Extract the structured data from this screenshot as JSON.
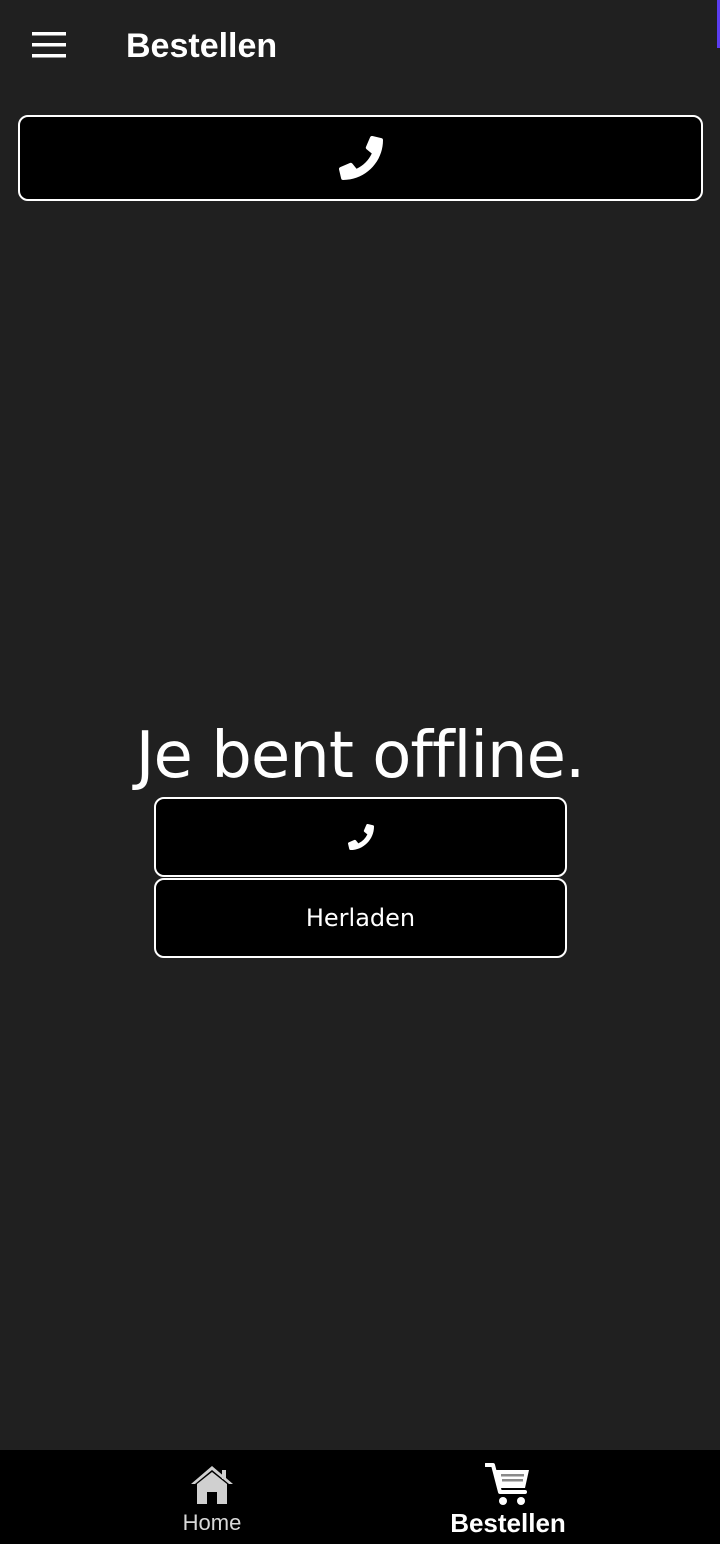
{
  "header": {
    "title": "Bestellen",
    "menu_icon": "hamburger-menu-icon"
  },
  "call_banner": {
    "icon": "phone-icon"
  },
  "offline": {
    "message": "Je bent offline.",
    "call_icon": "phone-icon",
    "reload_label": "Herladen"
  },
  "bottom_nav": {
    "items": [
      {
        "label": "Home",
        "icon": "home-icon",
        "active": false
      },
      {
        "label": "Bestellen",
        "icon": "cart-icon",
        "active": true
      }
    ]
  },
  "colors": {
    "background": "#202020",
    "button_bg": "#000000",
    "button_border": "#ffffff",
    "accent": "#5b3df0",
    "text": "#ffffff"
  }
}
